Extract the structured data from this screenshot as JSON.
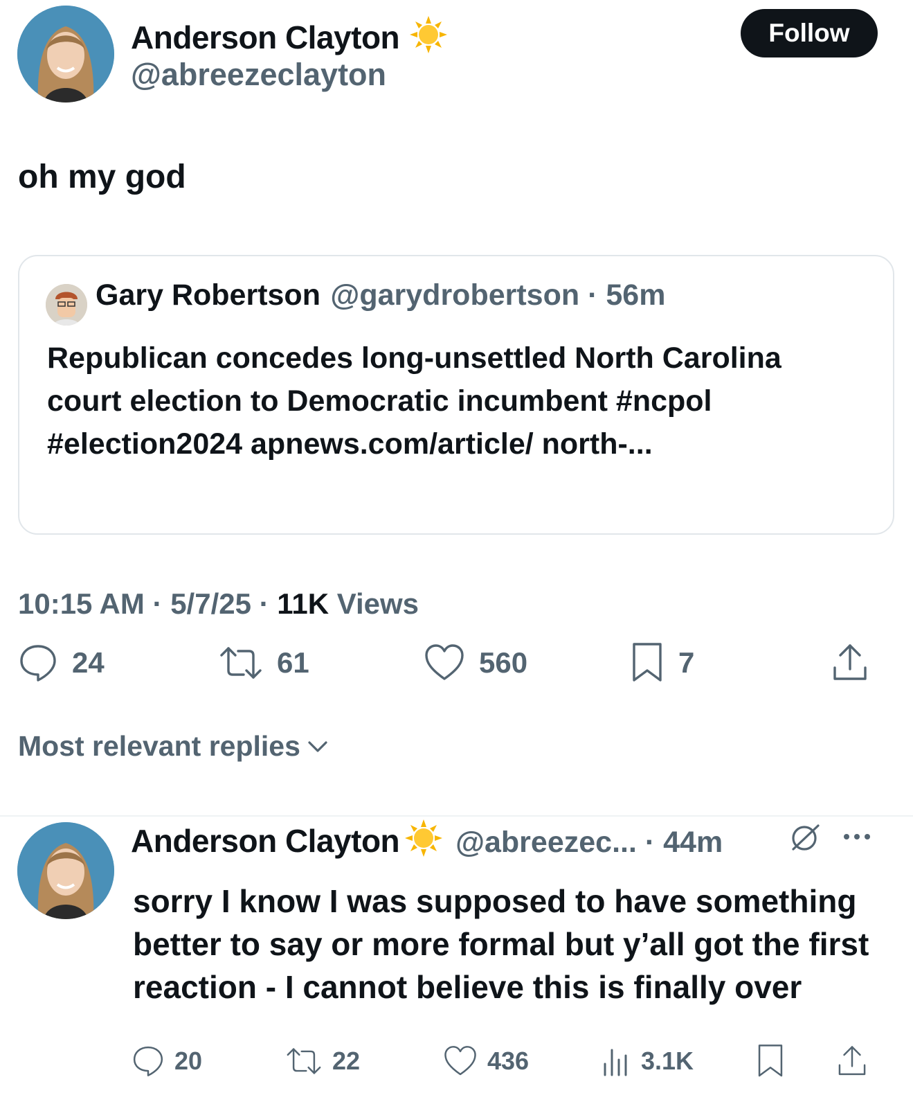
{
  "main_tweet": {
    "author_name": "Anderson Clayton",
    "author_emoji": "☀️",
    "author_handle": "@abreezeclayton",
    "follow_label": "Follow",
    "text": "oh my god",
    "timestamp": "10:15 AM",
    "date": "5/7/25",
    "views_count": "11K",
    "views_label": "Views",
    "stats": {
      "replies": "24",
      "reposts": "61",
      "likes": "560",
      "bookmarks": "7"
    }
  },
  "quoted_tweet": {
    "author_name": "Gary Robertson",
    "author_handle": "@garydrobertson",
    "time_ago": "56m",
    "text": "Republican concedes long-unsettled North Carolina court election to Democratic incumbent #ncpol #election2024 apnews.com/article/ north-..."
  },
  "replies_sort": {
    "label": "Most relevant replies"
  },
  "reply": {
    "author_name": "Anderson Clayton",
    "author_emoji": "☀️",
    "author_handle": "@abreezec...",
    "time_ago": "44m",
    "text": "sorry I know I was supposed to have something better to say or more formal but y’all got the first reaction - I cannot believe this is finally over",
    "stats": {
      "replies": "20",
      "reposts": "22",
      "likes": "436",
      "views": "3.1K"
    }
  },
  "colors": {
    "text_primary": "#0f1419",
    "text_secondary": "#536471",
    "border": "#e1e6ea",
    "button_bg": "#0f1419"
  },
  "icons": [
    "sun-emoji-icon",
    "reply-icon",
    "repost-icon",
    "like-icon",
    "bookmark-icon",
    "share-icon",
    "views-icon",
    "grok-icon",
    "more-icon",
    "chevron-down-icon"
  ]
}
